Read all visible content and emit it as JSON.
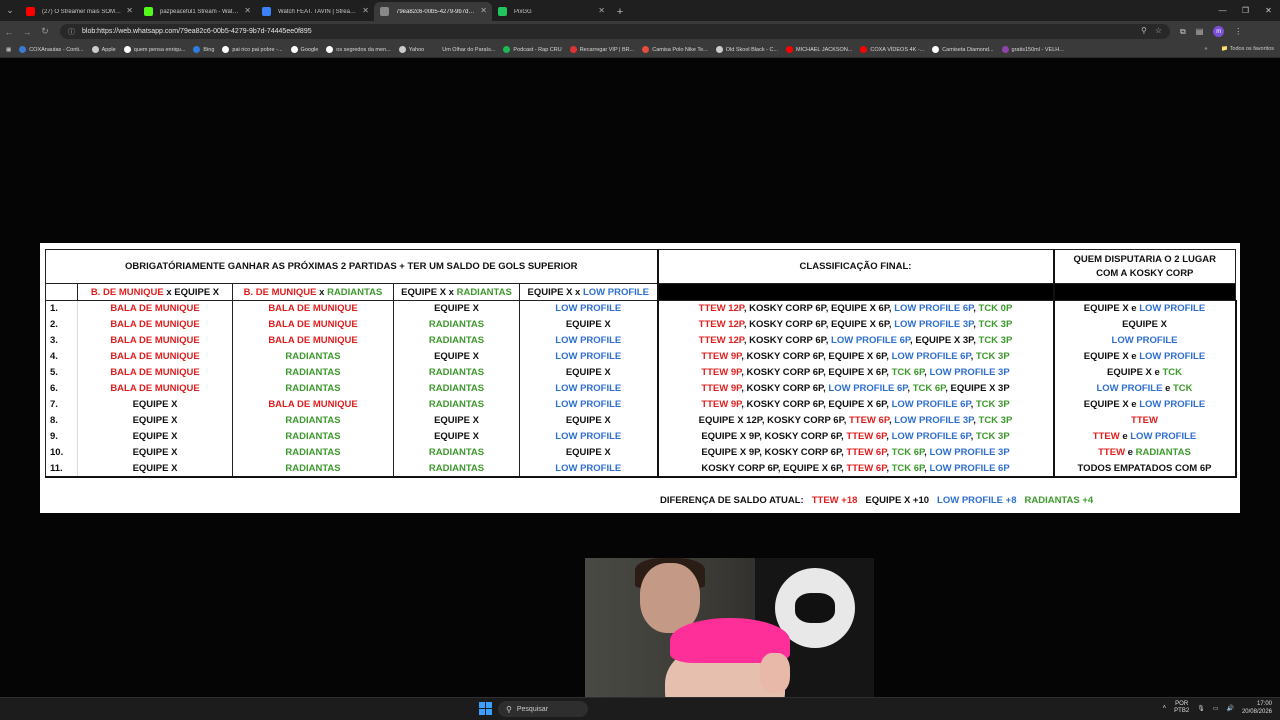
{
  "browser": {
    "tabs": [
      {
        "title": "(27) O Streamer mais SOMBRIO...",
        "color": "#ff0000"
      },
      {
        "title": "pazpeaceful1 Stream - Watch Li...",
        "color": "#53fc18"
      },
      {
        "title": "Watch FEAT. TAVIN | Streamabl...",
        "color": "#3b82f6"
      },
      {
        "title": "79ea82c6-00b5-4279-9b7d-744...",
        "color": "#888888"
      },
      {
        "title": "PixGG",
        "color": "#22c55e"
      }
    ],
    "active_tab_index": 3,
    "address": "blob:https://web.whatsapp.com/79ea82c6-00b5-4279-9b7d-74445ee0f895",
    "bookmarks": [
      {
        "label": "COXAnautas - Conti...",
        "color": "#3a7bd5"
      },
      {
        "label": "Apple",
        "color": "#cccccc"
      },
      {
        "label": "quem pensa enriqu...",
        "color": "#ffffff"
      },
      {
        "label": "Bing",
        "color": "#2f7de1"
      },
      {
        "label": "pai rico pai pobre -...",
        "color": "#ffffff"
      },
      {
        "label": "Google",
        "color": "#ffffff"
      },
      {
        "label": "os segredos da men...",
        "color": "#ffffff"
      },
      {
        "label": "Yahoo",
        "color": "#cccccc"
      },
      {
        "label": "Um Olhar do Paraís...",
        "color": "#3a3a3a"
      },
      {
        "label": "Podcast - Rap CRU",
        "color": "#1db954"
      },
      {
        "label": "Recarregar VIP | BR...",
        "color": "#d33"
      },
      {
        "label": "Camisa Polo Nike Te...",
        "color": "#e74c3c"
      },
      {
        "label": "Old Skool Black - C...",
        "color": "#cccccc"
      },
      {
        "label": "MICHAEL JACKSON...",
        "color": "#ff0000"
      },
      {
        "label": "COXA VÍDEOS 4K -...",
        "color": "#ff0000"
      },
      {
        "label": "Camiseta Diamond...",
        "color": "#ffffff"
      },
      {
        "label": "gratis150ml - VELH...",
        "color": "#8e44ad"
      }
    ],
    "all_bookmarks": "Todos os favoritos"
  },
  "sheet": {
    "header_left": "OBRIGATÓRIAMENTE GANHAR AS PRÓXIMAS 2 PARTIDAS + TER UM SALDO DE GOLS SUPERIOR",
    "header_mid": "CLASSIFICAÇÃO FINAL:",
    "header_right_1": "QUEM DISPUTARIA O 2 LUGAR",
    "header_right_2": "COM A KOSKY CORP",
    "matchups": [
      [
        {
          "t": "B. DE MUNIQUE",
          "c": "red"
        },
        {
          "t": " x ",
          "c": "black"
        },
        {
          "t": "EQUIPE X",
          "c": "black"
        }
      ],
      [
        {
          "t": "B. DE MUNIQUE",
          "c": "red"
        },
        {
          "t": " x ",
          "c": "black"
        },
        {
          "t": "RADIANTAS",
          "c": "green"
        }
      ],
      [
        {
          "t": "EQUIPE X",
          "c": "black"
        },
        {
          "t": " x ",
          "c": "black"
        },
        {
          "t": "RADIANTAS",
          "c": "green"
        }
      ],
      [
        {
          "t": "EQUIPE X",
          "c": "black"
        },
        {
          "t": " x ",
          "c": "black"
        },
        {
          "t": "LOW PROFILE",
          "c": "blue"
        }
      ]
    ],
    "rows": [
      {
        "n": "1.",
        "cells": [
          {
            "t": "BALA DE MUNIQUE",
            "c": "red"
          },
          {
            "t": "BALA DE MUNIQUE",
            "c": "red"
          },
          {
            "t": "EQUIPE X",
            "c": "black"
          },
          {
            "t": "LOW PROFILE",
            "c": "blue"
          }
        ],
        "final": [
          {
            "t": "TTEW 12P",
            "c": "red"
          },
          {
            "t": ", KOSKY CORP 6P, EQUIPE X 6P, ",
            "c": "black"
          },
          {
            "t": "LOW PROFILE 6P",
            "c": "blue"
          },
          {
            "t": ", ",
            "c": "black"
          },
          {
            "t": "TCK 0P",
            "c": "green"
          }
        ],
        "second": [
          {
            "t": "EQUIPE X",
            "c": "black"
          },
          {
            "t": " e ",
            "c": "black"
          },
          {
            "t": "LOW PROFILE",
            "c": "blue"
          }
        ]
      },
      {
        "n": "2.",
        "cells": [
          {
            "t": "BALA DE MUNIQUE",
            "c": "red"
          },
          {
            "t": "BALA DE MUNIQUE",
            "c": "red"
          },
          {
            "t": "RADIANTAS",
            "c": "green"
          },
          {
            "t": "EQUIPE X",
            "c": "black"
          }
        ],
        "final": [
          {
            "t": "TTEW 12P",
            "c": "red"
          },
          {
            "t": ", KOSKY CORP 6P, EQUIPE X 6P, ",
            "c": "black"
          },
          {
            "t": "LOW PROFILE 3P",
            "c": "blue"
          },
          {
            "t": ", ",
            "c": "black"
          },
          {
            "t": "TCK 3P",
            "c": "green"
          }
        ],
        "second": [
          {
            "t": "EQUIPE X",
            "c": "black"
          }
        ]
      },
      {
        "n": "3.",
        "cells": [
          {
            "t": "BALA DE MUNIQUE",
            "c": "red"
          },
          {
            "t": "BALA DE MUNIQUE",
            "c": "red"
          },
          {
            "t": "RADIANTAS",
            "c": "green"
          },
          {
            "t": "LOW PROFILE",
            "c": "blue"
          }
        ],
        "final": [
          {
            "t": "TTEW 12P",
            "c": "red"
          },
          {
            "t": ", KOSKY CORP 6P, ",
            "c": "black"
          },
          {
            "t": "LOW PROFILE 6P",
            "c": "blue"
          },
          {
            "t": ", EQUIPE X 3P, ",
            "c": "black"
          },
          {
            "t": "TCK 3P",
            "c": "green"
          }
        ],
        "second": [
          {
            "t": "LOW PROFILE",
            "c": "blue"
          }
        ]
      },
      {
        "n": "4.",
        "cells": [
          {
            "t": "BALA DE MUNIQUE",
            "c": "red"
          },
          {
            "t": "RADIANTAS",
            "c": "green"
          },
          {
            "t": "EQUIPE X",
            "c": "black"
          },
          {
            "t": "LOW PROFILE",
            "c": "blue"
          }
        ],
        "final": [
          {
            "t": "TTEW 9P",
            "c": "red"
          },
          {
            "t": ", KOSKY CORP 6P, EQUIPE X 6P, ",
            "c": "black"
          },
          {
            "t": "LOW PROFILE 6P",
            "c": "blue"
          },
          {
            "t": ", ",
            "c": "black"
          },
          {
            "t": "TCK 3P",
            "c": "green"
          }
        ],
        "second": [
          {
            "t": "EQUIPE X",
            "c": "black"
          },
          {
            "t": " e ",
            "c": "black"
          },
          {
            "t": "LOW PROFILE",
            "c": "blue"
          }
        ]
      },
      {
        "n": "5.",
        "cells": [
          {
            "t": "BALA DE MUNIQUE",
            "c": "red"
          },
          {
            "t": "RADIANTAS",
            "c": "green"
          },
          {
            "t": "RADIANTAS",
            "c": "green"
          },
          {
            "t": "EQUIPE X",
            "c": "black"
          }
        ],
        "final": [
          {
            "t": "TTEW 9P",
            "c": "red"
          },
          {
            "t": ", KOSKY CORP 6P, EQUIPE X 6P, ",
            "c": "black"
          },
          {
            "t": "TCK 6P",
            "c": "green"
          },
          {
            "t": ", ",
            "c": "black"
          },
          {
            "t": "LOW PROFILE 3P",
            "c": "blue"
          }
        ],
        "second": [
          {
            "t": "EQUIPE X",
            "c": "black"
          },
          {
            "t": " e ",
            "c": "black"
          },
          {
            "t": "TCK",
            "c": "green"
          }
        ]
      },
      {
        "n": "6.",
        "cells": [
          {
            "t": "BALA DE MUNIQUE",
            "c": "red"
          },
          {
            "t": "RADIANTAS",
            "c": "green"
          },
          {
            "t": "RADIANTAS",
            "c": "green"
          },
          {
            "t": "LOW PROFILE",
            "c": "blue"
          }
        ],
        "final": [
          {
            "t": "TTEW 9P",
            "c": "red"
          },
          {
            "t": ", KOSKY CORP 6P, ",
            "c": "black"
          },
          {
            "t": "LOW PROFILE 6P",
            "c": "blue"
          },
          {
            "t": ", ",
            "c": "black"
          },
          {
            "t": "TCK 6P",
            "c": "green"
          },
          {
            "t": ", EQUIPE X 3P",
            "c": "black"
          }
        ],
        "second": [
          {
            "t": "LOW PROFILE",
            "c": "blue"
          },
          {
            "t": " e ",
            "c": "black"
          },
          {
            "t": "TCK",
            "c": "green"
          }
        ]
      },
      {
        "n": "7.",
        "cells": [
          {
            "t": "EQUIPE X",
            "c": "black"
          },
          {
            "t": "BALA DE MUNIQUE",
            "c": "red"
          },
          {
            "t": "RADIANTAS",
            "c": "green"
          },
          {
            "t": "LOW PROFILE",
            "c": "blue"
          }
        ],
        "final": [
          {
            "t": "TTEW 9P",
            "c": "red"
          },
          {
            "t": ", KOSKY CORP 6P, EQUIPE X 6P, ",
            "c": "black"
          },
          {
            "t": "LOW PROFILE 6P",
            "c": "blue"
          },
          {
            "t": ", ",
            "c": "black"
          },
          {
            "t": "TCK 3P",
            "c": "green"
          }
        ],
        "second": [
          {
            "t": "EQUIPE X",
            "c": "black"
          },
          {
            "t": " e ",
            "c": "black"
          },
          {
            "t": "LOW PROFILE",
            "c": "blue"
          }
        ]
      },
      {
        "n": "8.",
        "cells": [
          {
            "t": "EQUIPE X",
            "c": "black"
          },
          {
            "t": "RADIANTAS",
            "c": "green"
          },
          {
            "t": "EQUIPE X",
            "c": "black"
          },
          {
            "t": "EQUIPE X",
            "c": "black"
          }
        ],
        "final": [
          {
            "t": "EQUIPE X 12P, KOSKY CORP 6P, ",
            "c": "black"
          },
          {
            "t": "TTEW 6P",
            "c": "red"
          },
          {
            "t": ", ",
            "c": "black"
          },
          {
            "t": "LOW PROFILE 3P",
            "c": "blue"
          },
          {
            "t": ", ",
            "c": "black"
          },
          {
            "t": "TCK 3P",
            "c": "green"
          }
        ],
        "second": [
          {
            "t": "TTEW",
            "c": "red"
          }
        ]
      },
      {
        "n": "9.",
        "cells": [
          {
            "t": "EQUIPE X",
            "c": "black"
          },
          {
            "t": "RADIANTAS",
            "c": "green"
          },
          {
            "t": "EQUIPE X",
            "c": "black"
          },
          {
            "t": "LOW PROFILE",
            "c": "blue"
          }
        ],
        "final": [
          {
            "t": "EQUIPE X 9P, KOSKY CORP 6P, ",
            "c": "black"
          },
          {
            "t": "TTEW 6P",
            "c": "red"
          },
          {
            "t": ", ",
            "c": "black"
          },
          {
            "t": "LOW PROFILE 6P",
            "c": "blue"
          },
          {
            "t": ", ",
            "c": "black"
          },
          {
            "t": "TCK 3P",
            "c": "green"
          }
        ],
        "second": [
          {
            "t": "TTEW",
            "c": "red"
          },
          {
            "t": " e ",
            "c": "black"
          },
          {
            "t": "LOW PROFILE",
            "c": "blue"
          }
        ]
      },
      {
        "n": "10.",
        "cells": [
          {
            "t": "EQUIPE X",
            "c": "black"
          },
          {
            "t": "RADIANTAS",
            "c": "green"
          },
          {
            "t": "RADIANTAS",
            "c": "green"
          },
          {
            "t": "EQUIPE X",
            "c": "black"
          }
        ],
        "final": [
          {
            "t": "EQUIPE X 9P, KOSKY CORP 6P, ",
            "c": "black"
          },
          {
            "t": "TTEW 6P",
            "c": "red"
          },
          {
            "t": ", ",
            "c": "black"
          },
          {
            "t": "TCK 6P",
            "c": "green"
          },
          {
            "t": ", ",
            "c": "black"
          },
          {
            "t": "LOW PROFILE 3P",
            "c": "blue"
          }
        ],
        "second": [
          {
            "t": "TTEW",
            "c": "red"
          },
          {
            "t": " e ",
            "c": "black"
          },
          {
            "t": "RADIANTAS",
            "c": "green"
          }
        ]
      },
      {
        "n": "11.",
        "cells": [
          {
            "t": "EQUIPE X",
            "c": "black"
          },
          {
            "t": "RADIANTAS",
            "c": "green"
          },
          {
            "t": "RADIANTAS",
            "c": "green"
          },
          {
            "t": "LOW PROFILE",
            "c": "blue"
          }
        ],
        "final": [
          {
            "t": "KOSKY CORP 6P, EQUIPE X 6P, ",
            "c": "black"
          },
          {
            "t": "TTEW 6P",
            "c": "red"
          },
          {
            "t": ", ",
            "c": "black"
          },
          {
            "t": "TCK 6P",
            "c": "green"
          },
          {
            "t": ", ",
            "c": "black"
          },
          {
            "t": "LOW PROFILE 6P",
            "c": "blue"
          }
        ],
        "second": [
          {
            "t": "TODOS EMPATADOS COM 6P",
            "c": "black"
          }
        ]
      }
    ],
    "diff": [
      {
        "t": "DIFERENÇA DE SALDO ATUAL:",
        "c": "black"
      },
      {
        "t": "TTEW +18",
        "c": "red"
      },
      {
        "t": "EQUIPE X +10",
        "c": "black"
      },
      {
        "t": "LOW PROFILE +8",
        "c": "blue"
      },
      {
        "t": "RADIANTAS +4",
        "c": "green"
      }
    ]
  },
  "taskbar": {
    "search_placeholder": "Pesquisar",
    "lang_1": "POR",
    "lang_2": "PTB2",
    "time": "17:00",
    "date": "20/08/2026"
  }
}
